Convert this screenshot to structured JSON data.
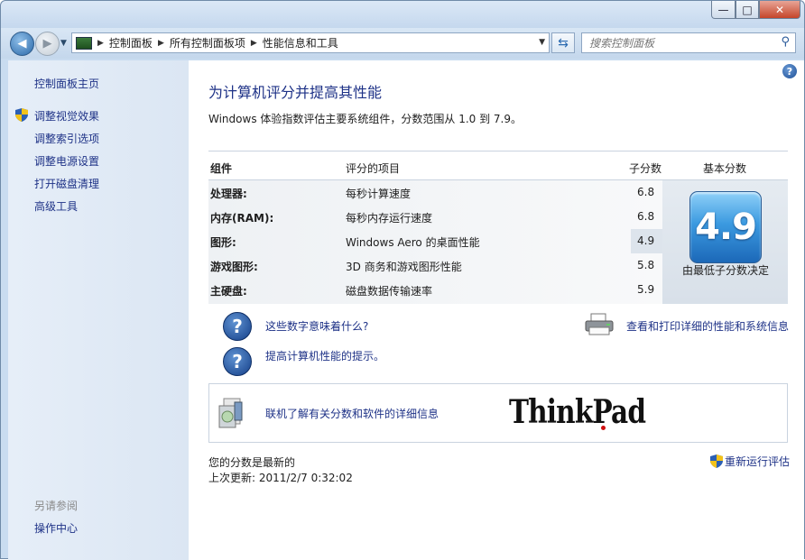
{
  "window": {
    "controls": {
      "minimize": "—",
      "maximize": "□",
      "close": "✕"
    }
  },
  "toolbar": {
    "back_glyph": "◀",
    "forward_glyph": "▶",
    "breadcrumb": [
      "控制面板",
      "所有控制面板项",
      "性能信息和工具"
    ],
    "search_placeholder": "搜索控制面板"
  },
  "sidebar": {
    "home": "控制面板主页",
    "items": [
      "调整视觉效果",
      "调整索引选项",
      "调整电源设置",
      "打开磁盘清理",
      "高级工具"
    ],
    "see_also_title": "另请参阅",
    "see_also": [
      "操作中心"
    ]
  },
  "main": {
    "title": "为计算机评分并提高其性能",
    "description": "Windows 体验指数评估主要系统组件，分数范围从 1.0 到 7.9。",
    "headers": {
      "component": "组件",
      "rated": "评分的项目",
      "subscore": "子分数",
      "base": "基本分数"
    },
    "rows": [
      {
        "component": "处理器:",
        "item": "每秒计算速度",
        "score": "6.8"
      },
      {
        "component": "内存(RAM):",
        "item": "每秒内存运行速度",
        "score": "6.8"
      },
      {
        "component": "图形:",
        "item": "Windows Aero 的桌面性能",
        "score": "4.9"
      },
      {
        "component": "游戏图形:",
        "item": "3D 商务和游戏图形性能",
        "score": "5.8"
      },
      {
        "component": "主硬盘:",
        "item": "磁盘数据传输速率",
        "score": "5.9"
      }
    ],
    "base_score": "4.9",
    "base_note": "由最低子分数决定",
    "links": {
      "what_mean": "这些数字意味着什么?",
      "tips": "提高计算机性能的提示。",
      "print": "查看和打印详细的性能和系统信息",
      "online": "联机了解有关分数和软件的详细信息"
    },
    "brand_logo": "ThinkPad",
    "status_current": "您的分数是最新的",
    "last_update": "上次更新: 2011/2/7 0:32:02",
    "rerun": "重新运行评估"
  }
}
